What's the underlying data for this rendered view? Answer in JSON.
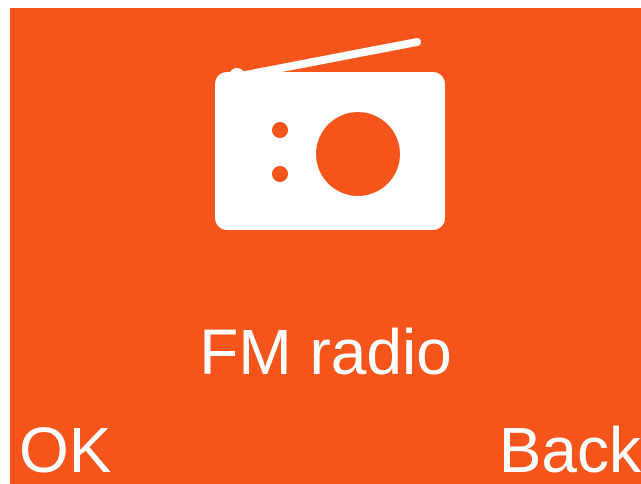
{
  "screen": {
    "background_color": "#f5541a",
    "foreground_color": "#ffffff"
  },
  "app": {
    "icon": "radio-icon",
    "title": "FM radio"
  },
  "softkeys": {
    "left_label": "OK",
    "right_label": "Back"
  }
}
